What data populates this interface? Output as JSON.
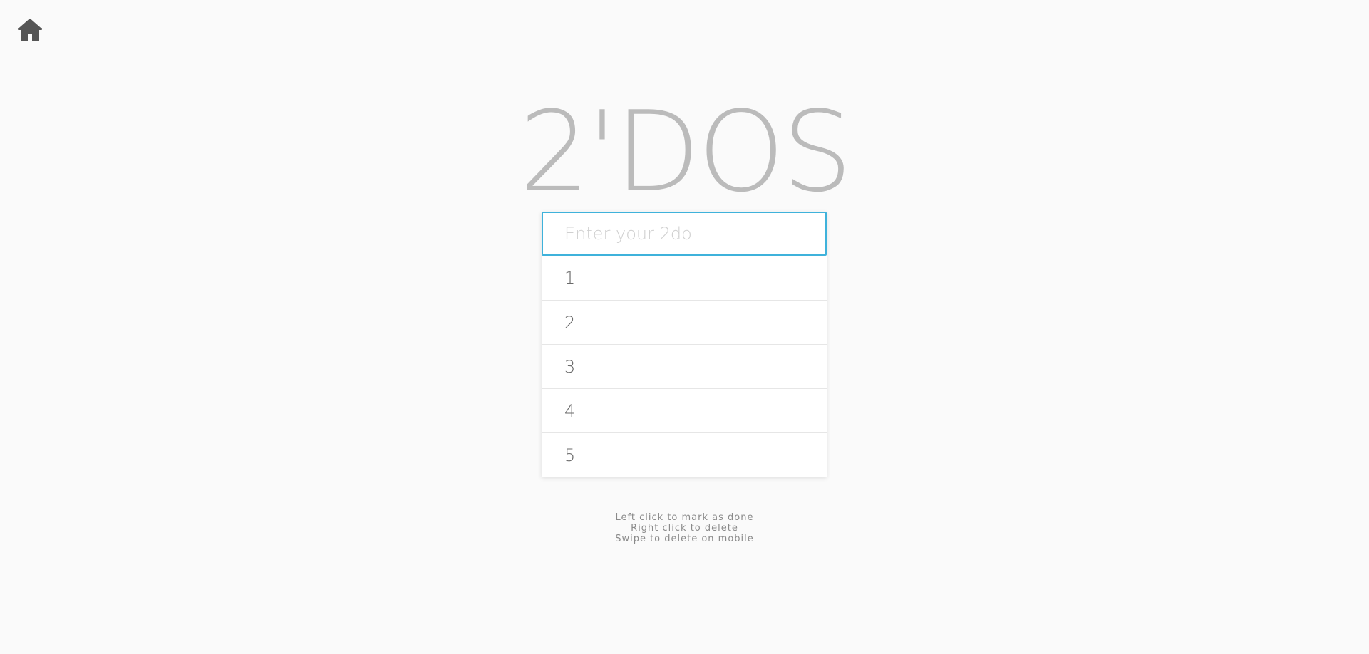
{
  "nav": {
    "home_icon": "home-icon"
  },
  "header": {
    "title": "2'DOS"
  },
  "input": {
    "placeholder": "Enter your 2do",
    "value": ""
  },
  "todos": [
    {
      "label": "1"
    },
    {
      "label": "2"
    },
    {
      "label": "3"
    },
    {
      "label": "4"
    },
    {
      "label": "5"
    }
  ],
  "instructions": {
    "line1": "Left click to mark as done",
    "line2": "Right click to delete",
    "line3": "Swipe to delete on mobile"
  },
  "colors": {
    "background": "#fafafa",
    "title": "#bbbbbb",
    "input_border": "#3fb2db",
    "item_text": "#6a6a6a",
    "icon": "#555555"
  }
}
